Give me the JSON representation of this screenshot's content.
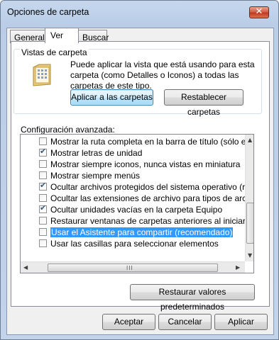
{
  "window": {
    "title": "Opciones de carpeta",
    "close_glyph": "✕"
  },
  "tabs": [
    {
      "label": "General"
    },
    {
      "label": "Ver"
    },
    {
      "label": "Buscar"
    }
  ],
  "folder_views": {
    "legend": "Vistas de carpeta",
    "description": "Puede aplicar la vista que está usando para esta carpeta (como Detalles o Iconos) a todas las carpetas de este tipo.",
    "apply_button": "Aplicar a las carpetas",
    "reset_button": "Restablecer carpetas",
    "icon": "folder-view-icon"
  },
  "advanced": {
    "label": "Configuración avanzada:",
    "items": [
      {
        "text": "Mostrar la ruta completa en la barra de título (sólo el tema",
        "checked": false
      },
      {
        "text": "Mostrar letras de unidad",
        "checked": true
      },
      {
        "text": "Mostrar siempre iconos, nunca vistas en miniatura",
        "checked": false
      },
      {
        "text": "Mostrar siempre menús",
        "checked": false
      },
      {
        "text": "Ocultar archivos protegidos del sistema operativo (recome",
        "checked": true
      },
      {
        "text": "Ocultar las extensiones de archivo para tipos de archivo c",
        "checked": false
      },
      {
        "text": "Ocultar unidades vacías en la carpeta Equipo",
        "checked": true
      },
      {
        "text": "Restaurar ventanas de carpetas anteriores al iniciar sesió",
        "checked": false
      },
      {
        "text": "Usar el Asistente para compartir (recomendado)",
        "checked": false,
        "selected": true
      },
      {
        "text": "Usar las casillas para seleccionar elementos",
        "checked": false
      }
    ],
    "scroll": {
      "up": "▲",
      "down": "▼",
      "left": "◀",
      "right": "▶",
      "grip": "III",
      "vertical_position": 0.6,
      "horizontal_position": 0.1
    }
  },
  "restore_defaults_button": "Restaurar valores predeterminados",
  "dialog_buttons": {
    "accept": "Aceptar",
    "cancel": "Cancelar",
    "apply": "Aplicar"
  },
  "check_glyph": "✔"
}
